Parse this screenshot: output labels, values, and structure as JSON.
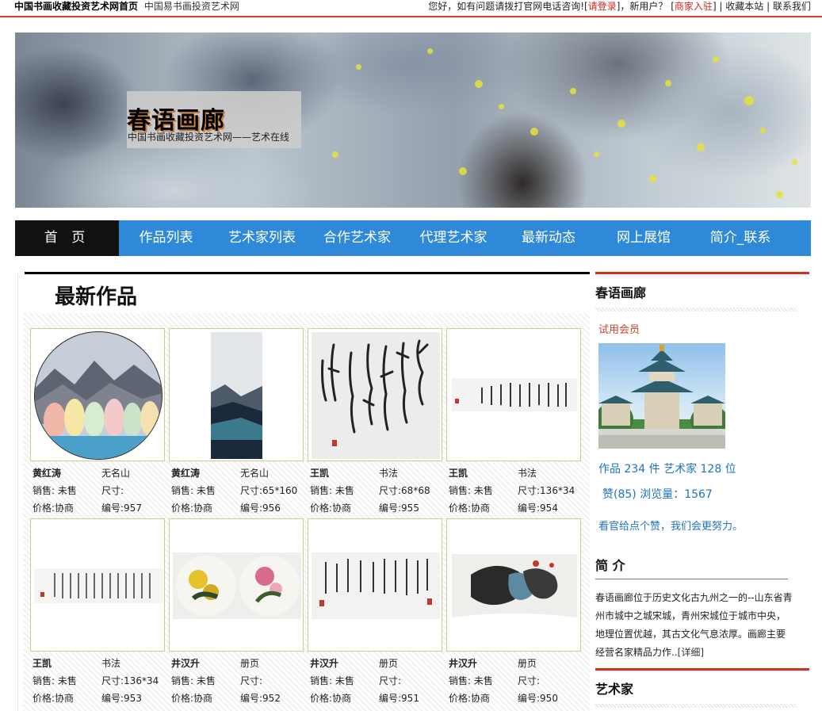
{
  "topbar": {
    "site_home": "中国书画收藏投资艺术网首页",
    "site_sub": "中国易书画投资艺术网",
    "greeting": "您好，如有问题请拨打官网电话咨询![",
    "login": "请登录",
    "new_user": "]，新用户？ [",
    "merchant": "商家入驻",
    "sep1": "] | ",
    "bookmark": "收藏本站",
    "sep2": " | ",
    "contact": "联系我们"
  },
  "banner": {
    "title": "春语画廊",
    "subtitle": "中国书画收藏投资艺术网——艺术在线"
  },
  "nav": [
    "首 页",
    "作品列表",
    "艺术家列表",
    "合作艺术家",
    "代理艺术家",
    "最新动态",
    "网上展馆",
    "简介_联系"
  ],
  "main": {
    "title": "最新作品",
    "works": [
      {
        "artist": "黄红涛",
        "name": "无名山",
        "sale": "销售: 未售",
        "size": "尺寸:",
        "price": "价格:协商",
        "no": "编号:957"
      },
      {
        "artist": "黄红涛",
        "name": "无名山",
        "sale": "销售: 未售",
        "size": "尺寸:65*160",
        "price": "价格:协商",
        "no": "编号:956"
      },
      {
        "artist": "王凯",
        "name": "书法",
        "sale": "销售: 未售",
        "size": "尺寸:68*68",
        "price": "价格:协商",
        "no": "编号:955"
      },
      {
        "artist": "王凯",
        "name": "书法",
        "sale": "销售: 未售",
        "size": "尺寸:136*34",
        "price": "价格:协商",
        "no": "编号:954"
      },
      {
        "artist": "王凯",
        "name": "书法",
        "sale": "销售: 未售",
        "size": "尺寸:136*34",
        "price": "价格:协商",
        "no": "编号:953"
      },
      {
        "artist": "井汉升",
        "name": "册页",
        "sale": "销售: 未售",
        "size": "尺寸:",
        "price": "价格:协商",
        "no": "编号:952"
      },
      {
        "artist": "井汉升",
        "name": "册页",
        "sale": "销售: 未售",
        "size": "尺寸:",
        "price": "价格:协商",
        "no": "编号:951"
      },
      {
        "artist": "井汉升",
        "name": "册页",
        "sale": "销售: 未售",
        "size": "尺寸:",
        "price": "价格:协商",
        "no": "编号:950"
      }
    ]
  },
  "side": {
    "gallery_title": "春语画廊",
    "member": "试用会员",
    "stats": "作品 234 件  艺术家 128 位",
    "likes": "赞(85) 浏览量：1567",
    "encourage": "看官给点个赞，我们会更努力。",
    "intro_title": "简 介",
    "intro": "春语画廊位于历史文化古九州之一的--山东省青州市城中之城宋城，青州宋城位于城市中央，地理位置优越，其古文化气息浓厚。画廊主要经营名家精品力作..",
    "more": "[详细]",
    "artists_title": "艺术家"
  }
}
